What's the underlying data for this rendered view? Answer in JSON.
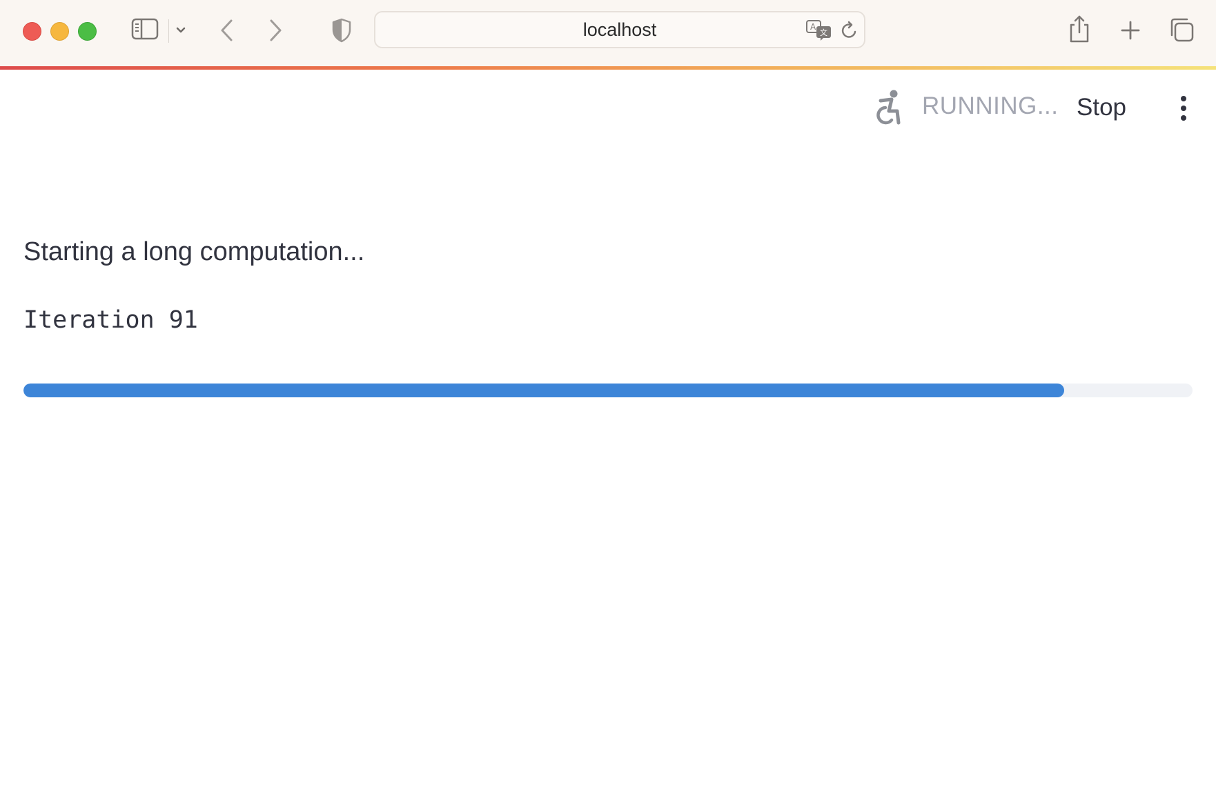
{
  "browser": {
    "address": "localhost",
    "icons": {
      "sidebar": "sidebar-icon",
      "chevron": "chevron-down-icon",
      "back": "back-arrow-icon",
      "forward": "forward-arrow-icon",
      "shield": "shield-icon",
      "translate": "translate-icon",
      "reload": "reload-icon",
      "share": "share-icon",
      "new_tab": "plus-icon",
      "tabs": "tab-overview-icon"
    }
  },
  "app": {
    "status": "RUNNING...",
    "stop_label": "Stop",
    "running_icon": "running-person-icon",
    "menu_icon": "kebab-menu-icon"
  },
  "content": {
    "message": "Starting a long computation...",
    "iteration": "Iteration 91",
    "progress_percent": 89
  },
  "colors": {
    "progress": "#3d85d8",
    "track": "#f0f2f6",
    "status_text": "#a3a6b1",
    "body_text": "#31333f"
  }
}
